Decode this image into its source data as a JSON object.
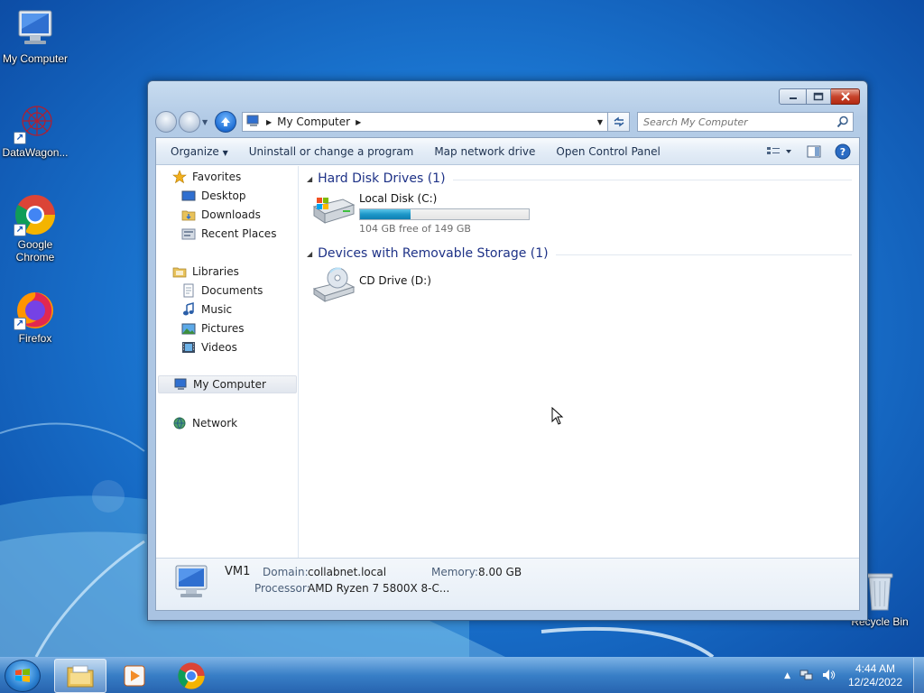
{
  "desktop": {
    "icons": [
      {
        "label": "My Computer",
        "icon": "computer-icon"
      },
      {
        "label": "DataWagon...",
        "icon": "datawagon-icon"
      },
      {
        "label": "Google Chrome",
        "icon": "chrome-icon"
      },
      {
        "label": "Firefox",
        "icon": "firefox-icon"
      },
      {
        "label": "Recycle Bin",
        "icon": "recycle-bin-icon"
      }
    ]
  },
  "window": {
    "address": {
      "crumb": "My Computer"
    },
    "search": {
      "placeholder": "Search My Computer"
    },
    "toolbar": {
      "organize": "Organize",
      "uninstall": "Uninstall or change a program",
      "map_drive": "Map network drive",
      "control_panel": "Open Control Panel"
    },
    "navpane": {
      "favorites": "Favorites",
      "desktop": "Desktop",
      "downloads": "Downloads",
      "recent": "Recent Places",
      "libraries": "Libraries",
      "documents": "Documents",
      "music": "Music",
      "pictures": "Pictures",
      "videos": "Videos",
      "computer": "My Computer",
      "network": "Network"
    },
    "groups": {
      "hdd": {
        "title": "Hard Disk Drives (1)"
      },
      "removable": {
        "title": "Devices with Removable Storage (1)"
      }
    },
    "drives": {
      "c": {
        "name": "Local Disk (C:)",
        "free_text": "104 GB free of 149 GB",
        "used_fraction": 0.3
      },
      "d": {
        "name": "CD Drive (D:)"
      }
    },
    "details": {
      "name": "VM1",
      "domain_label": "Domain:",
      "domain_value": "collabnet.local",
      "memory_label": "Memory:",
      "memory_value": "8.00 GB",
      "processor_label": "Processor:",
      "processor_value": "AMD Ryzen 7 5800X 8-C..."
    }
  },
  "taskbar": {
    "apps": [
      "explorer-icon",
      "media-player-icon",
      "chrome-icon"
    ],
    "clock": {
      "time": "4:44 AM",
      "date": "12/24/2022"
    }
  },
  "colors": {
    "accent": "#1e3287",
    "bar_fill": "#1d97c9",
    "close": "#c7432b"
  }
}
